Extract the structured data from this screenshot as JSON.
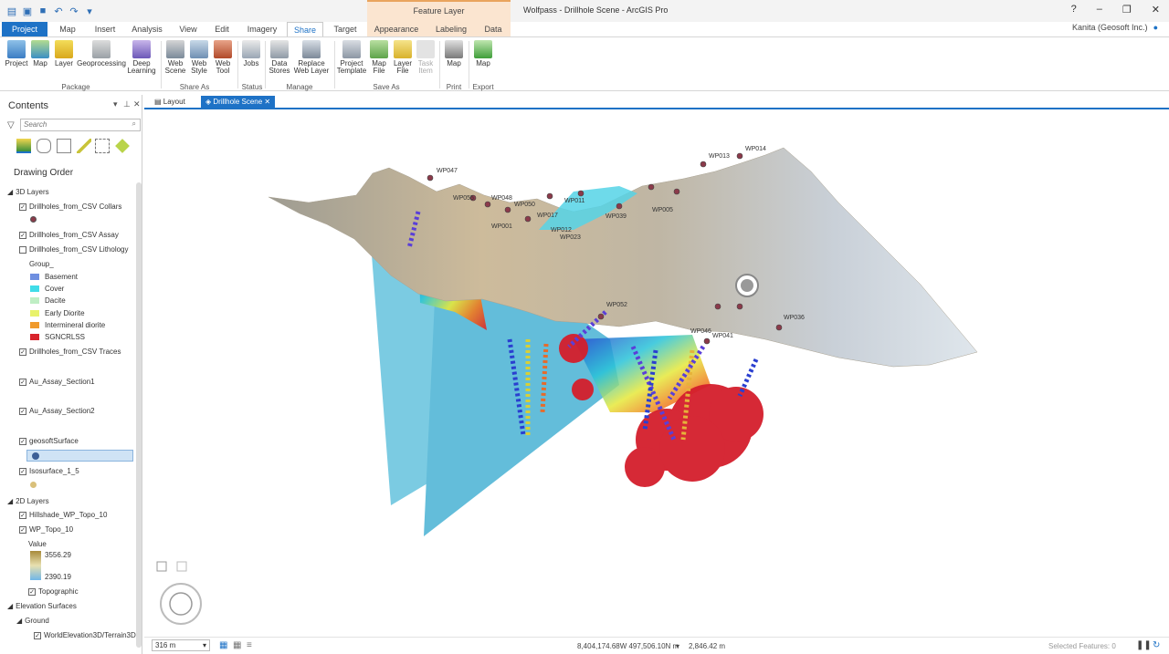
{
  "app": {
    "title": "Wolfpass - Drillhole Scene - ArcGIS Pro",
    "context_tab_group": "Feature Layer"
  },
  "tabs": [
    "Project",
    "Map",
    "Insert",
    "Analysis",
    "View",
    "Edit",
    "Imagery",
    "Share",
    "Target",
    "Appearance",
    "Labeling",
    "Data"
  ],
  "active_tab": "Share",
  "user": "Kanita (Geosoft Inc.)",
  "ribbon": {
    "buttons": [
      {
        "label1": "Project",
        "label2": ""
      },
      {
        "label1": "Map",
        "label2": ""
      },
      {
        "label1": "Layer",
        "label2": ""
      },
      {
        "label1": "Geoprocessing",
        "label2": ""
      },
      {
        "label1": "Deep",
        "label2": "Learning"
      },
      {
        "label1": "Web",
        "label2": "Scene"
      },
      {
        "label1": "Web",
        "label2": "Style"
      },
      {
        "label1": "Web",
        "label2": "Tool"
      },
      {
        "label1": "Jobs",
        "label2": ""
      },
      {
        "label1": "Data",
        "label2": "Stores"
      },
      {
        "label1": "Replace",
        "label2": "Web Layer"
      },
      {
        "label1": "Project",
        "label2": "Template"
      },
      {
        "label1": "Map",
        "label2": "File"
      },
      {
        "label1": "Layer",
        "label2": "File"
      },
      {
        "label1": "Task",
        "label2": "Item"
      },
      {
        "label1": "Map",
        "label2": ""
      },
      {
        "label1": "Map",
        "label2": ""
      }
    ],
    "groups": [
      "Package",
      "Share As",
      "Status",
      "Manage",
      "Save As",
      "Print",
      "Export"
    ]
  },
  "contents": {
    "title": "Contents",
    "search_placeholder": "Search",
    "drawing_order": "Drawing Order",
    "tree": [
      {
        "text": "3D Layers",
        "kind": "group"
      },
      {
        "text": "Drillholes_from_CSV Collars",
        "kind": "layer",
        "checked": true
      },
      {
        "text": "Drillholes_from_CSV Assay",
        "kind": "layer",
        "checked": true
      },
      {
        "text": "Drillholes_from_CSV Lithology",
        "kind": "layer",
        "checked": false
      },
      {
        "text": "Group_",
        "kind": "heading"
      },
      {
        "text": "Basement",
        "kind": "legend",
        "color": "#6f8fe0"
      },
      {
        "text": "Cover",
        "kind": "legend",
        "color": "#40dce8"
      },
      {
        "text": "Dacite",
        "kind": "legend",
        "color": "#bfeec4"
      },
      {
        "text": "Early Diorite",
        "kind": "legend",
        "color": "#e8f26a"
      },
      {
        "text": "Intermineral diorite",
        "kind": "legend",
        "color": "#f09a2c"
      },
      {
        "text": "SGNCRLSS",
        "kind": "legend",
        "color": "#d8242c"
      },
      {
        "text": "Drillholes_from_CSV Traces",
        "kind": "layer",
        "checked": true
      },
      {
        "text": "Au_Assay_Section1",
        "kind": "layer",
        "checked": true
      },
      {
        "text": "Au_Assay_Section2",
        "kind": "layer",
        "checked": true
      },
      {
        "text": "geosoftSurface",
        "kind": "layer",
        "checked": true
      },
      {
        "text": "Isosurface_1_5",
        "kind": "layer",
        "checked": true
      },
      {
        "text": "2D Layers",
        "kind": "group"
      },
      {
        "text": "Hillshade_WP_Topo_10",
        "kind": "layer",
        "checked": true
      },
      {
        "text": "WP_Topo_10",
        "kind": "layer",
        "checked": true
      },
      {
        "text": "Value",
        "kind": "heading"
      },
      {
        "text": "Topographic",
        "kind": "layer",
        "checked": true
      },
      {
        "text": "Elevation Surfaces",
        "kind": "group"
      },
      {
        "text": "Ground",
        "kind": "group"
      },
      {
        "text": "WorldElevation3D/Terrain3D",
        "kind": "layer",
        "checked": true
      }
    ],
    "ramp_max": "3556.29",
    "ramp_min": "2390.19"
  },
  "view_tabs": [
    "Layout",
    "Drillhole Scene"
  ],
  "active_view": "Drillhole Scene",
  "scene_labels": [
    "WP047",
    "WP055",
    "WP048",
    "WP050",
    "WP001",
    "WP017",
    "WP012",
    "WP023",
    "WP013",
    "WP014",
    "WP005",
    "WP039",
    "WP052",
    "WP046",
    "WP041",
    "WP036",
    "WP011"
  ],
  "status": {
    "scale": "316 m",
    "coordinates": "8,404,174.68W 497,506.10N m",
    "elevation": "2,846.42 m",
    "selected": "Selected Features: 0"
  },
  "colors": {
    "accent": "#1e72c6",
    "context": "#fbe5d0",
    "terrain": "#c9b89a",
    "section": "#6ecbe0",
    "ore": "#d41e2c"
  }
}
